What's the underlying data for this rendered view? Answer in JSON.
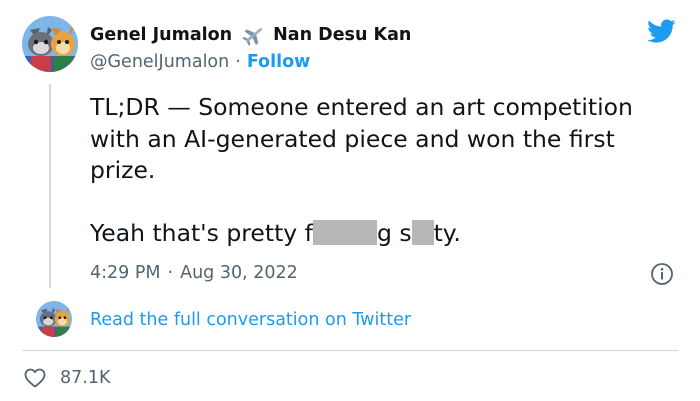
{
  "author": {
    "display_name": "Genel Jumalon",
    "display_name_suffix": "Nan Desu Kan",
    "handle": "@GenelJumalon",
    "separator": "·",
    "follow_label": "Follow"
  },
  "tweet": {
    "paragraph1": "TL;DR — Someone entered an art competition with an AI-generated piece and won the first prize.",
    "p2_part1": "Yeah that's pretty f",
    "p2_part2": "g s",
    "p2_part3": "ty.",
    "time": "4:29 PM",
    "separator": "·",
    "date": "Aug 30, 2022"
  },
  "conversation_link": "Read the full conversation on Twitter",
  "likes": "87.1K",
  "colors": {
    "accent": "#1d9bf0",
    "muted": "#536471",
    "text": "#0f1419",
    "redaction": "#b7b7b7"
  },
  "icons": [
    "airplane-icon",
    "twitter-bird-icon",
    "info-icon",
    "heart-icon"
  ]
}
